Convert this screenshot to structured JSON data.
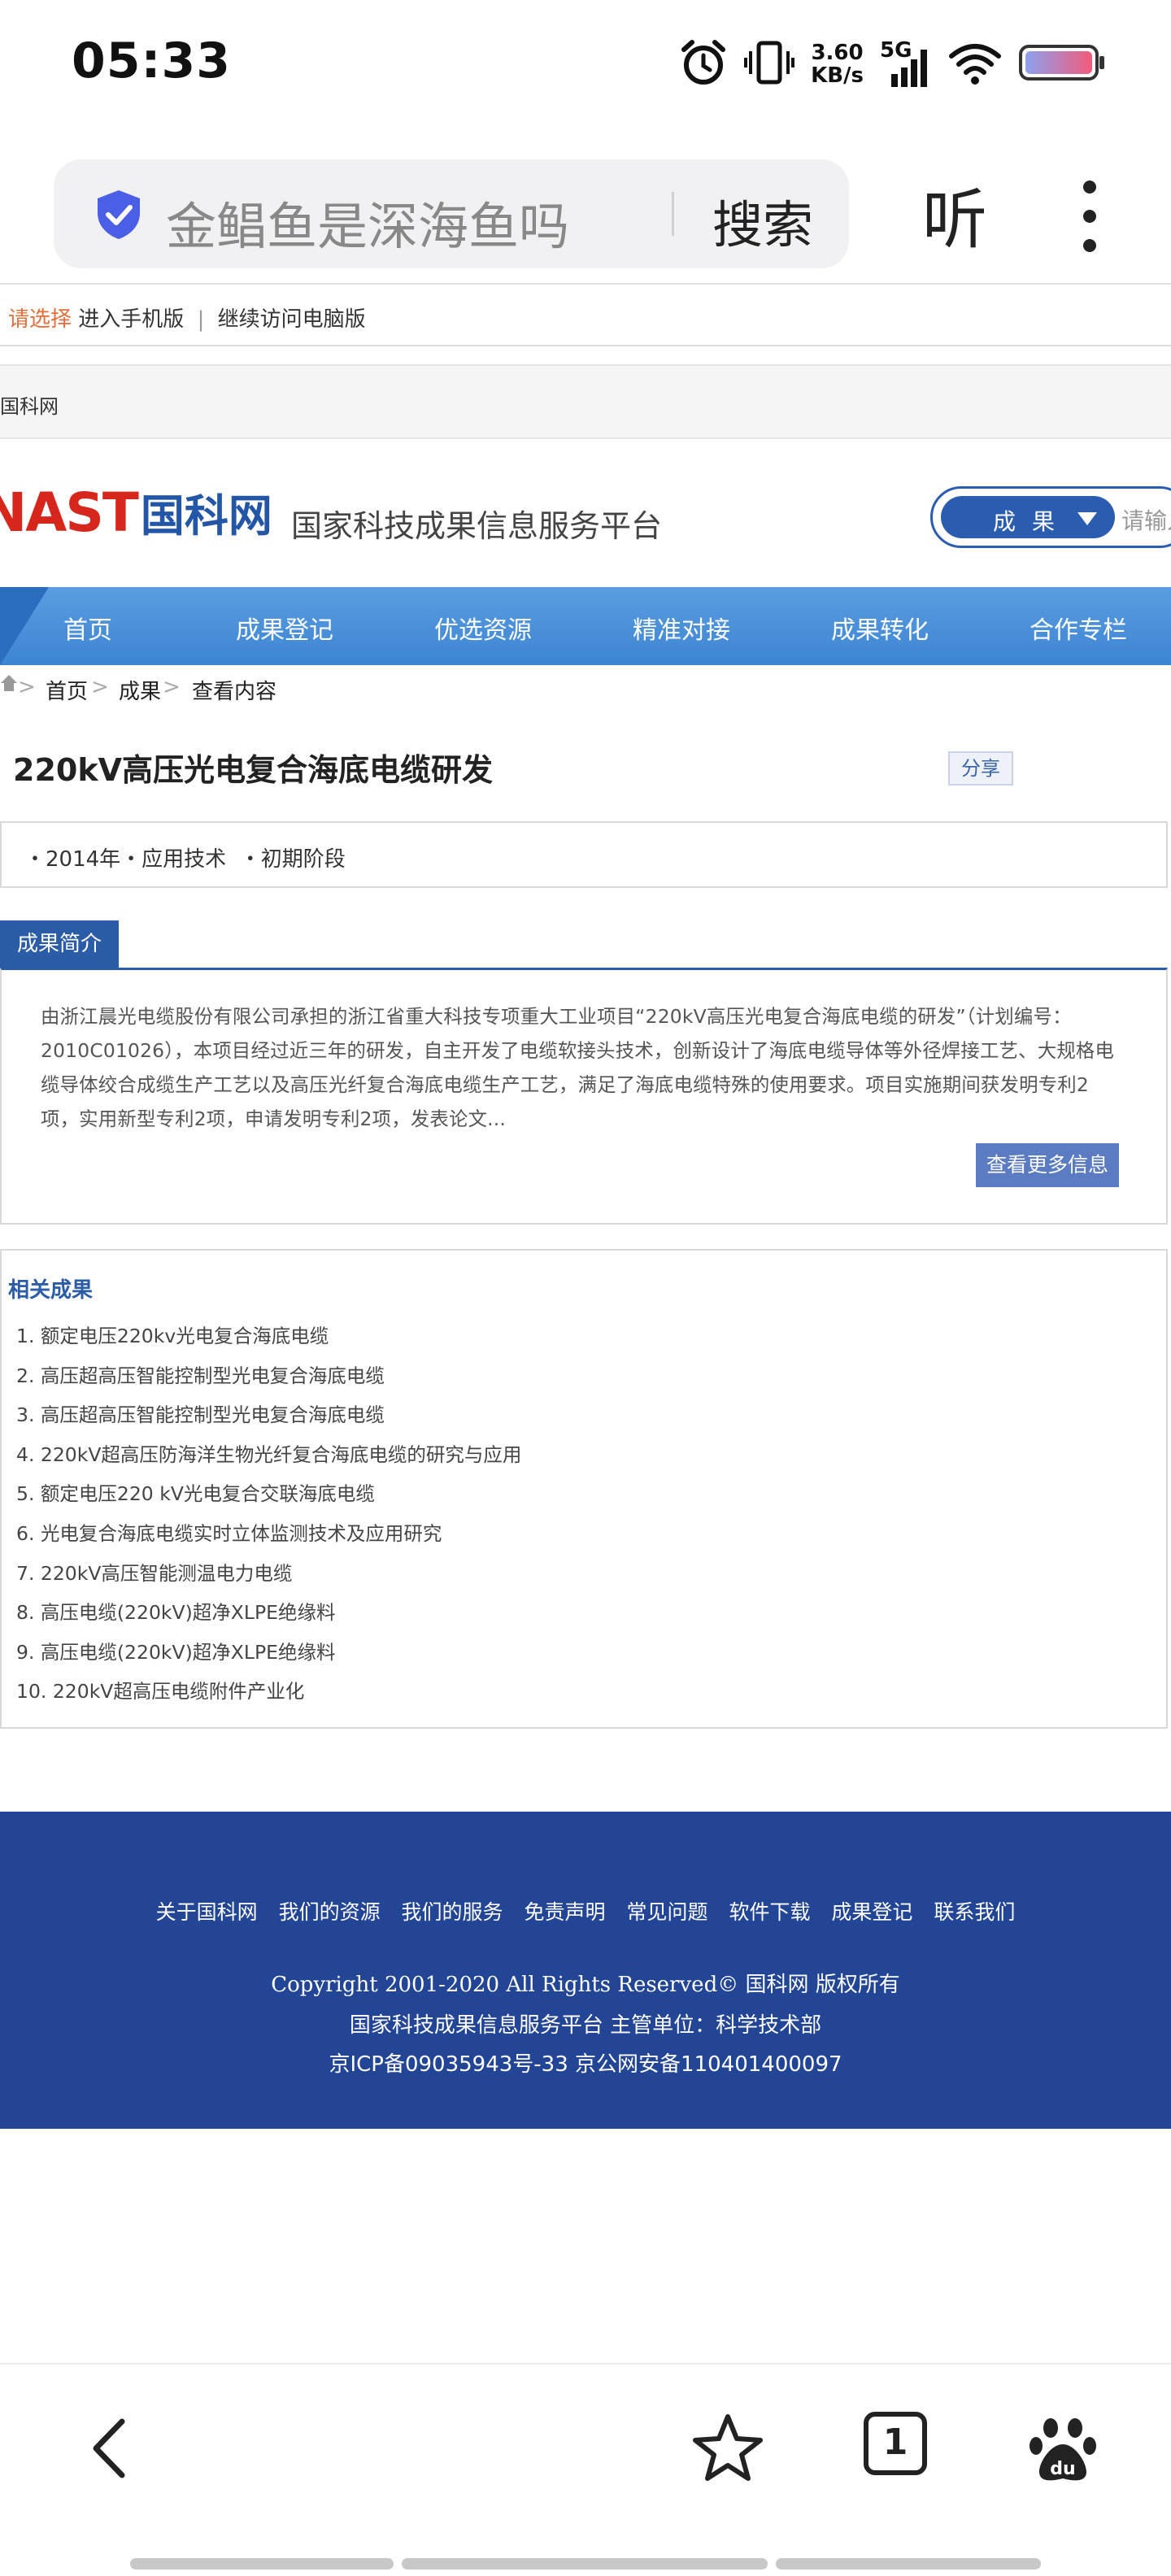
{
  "status_bar": {
    "time": "05:33",
    "net_speed_value": "3.60",
    "net_speed_unit": "KB/s",
    "network": "5G",
    "icons": [
      "alarm-icon",
      "vibrate-icon",
      "signal-icon",
      "wifi-icon",
      "battery-icon"
    ]
  },
  "browser": {
    "search_query": "金鲳鱼是深海鱼吗",
    "search_button": "搜索",
    "listen_button": "听"
  },
  "choose_bar": {
    "label": "请选择",
    "mobile": "进入手机版",
    "separator": "|",
    "desktop": "继续访问电脑版"
  },
  "top_strip": {
    "text": "国科网"
  },
  "header": {
    "logo_nast": "NAST",
    "logo_cn": "国科网",
    "subtitle": "国家科技成果信息服务平台",
    "search_category": "成果",
    "search_placeholder": "请输入"
  },
  "nav": {
    "items": [
      "首页",
      "成果登记",
      "优选资源",
      "精准对接",
      "成果转化",
      "合作专栏"
    ]
  },
  "breadcrumb": {
    "items": [
      "首页",
      "成果",
      "查看内容"
    ]
  },
  "article": {
    "title": "220kV高压光电复合海底电缆研发",
    "share": "分享",
    "meta": "・2014年・应用技术  ・初期阶段",
    "intro_tab": "成果简介",
    "intro": "由浙江晨光电缆股份有限公司承担的浙江省重大科技专项重大工业项目“220kV高压光电复合海底电缆的研发”（计划编号：2010C01026），本项目经过近三年的研发，自主开发了电缆软接头技术，创新设计了海底电缆导体等外径焊接工艺、大规格电缆导体绞合成缆生产工艺以及高压光纤复合海底电缆生产工艺，满足了海底电缆特殊的使用要求。项目实施期间获发明专利2项，实用新型专利2项，申请发明专利2项，发表论文...",
    "more_button": "查看更多信息"
  },
  "related": {
    "title": "相关成果",
    "items": [
      "1. 额定电压220kv光电复合海底电缆",
      "2. 高压超高压智能控制型光电复合海底电缆",
      "3. 高压超高压智能控制型光电复合海底电缆",
      "4. 220kV超高压防海洋生物光纤复合海底电缆的研究与应用",
      "5. 额定电压220 kV光电复合交联海底电缆",
      "6. 光电复合海底电缆实时立体监测技术及应用研究",
      "7. 220kV高压智能测温电力电缆",
      "8. 高压电缆(220kV)超净XLPE绝缘料",
      "9. 高压电缆(220kV)超净XLPE绝缘料",
      "10. 220kV超高压电缆附件产业化"
    ]
  },
  "footer": {
    "links": [
      "关于国科网",
      "我们的资源",
      "我们的服务",
      "免责声明",
      "常见问题",
      "软件下载",
      "成果登记",
      "联系我们"
    ],
    "copyright": "Copyright 2001-2020 All Rights Reserved© 国科网 版权所有",
    "line2": "国家科技成果信息服务平台   主管单位：科学技术部",
    "line3": "京ICP备09035943号-33  京公网安备110401400097"
  },
  "toolbar": {
    "tab_count": "1",
    "icons": [
      "back-icon",
      "star-icon",
      "tabs-icon",
      "baidu-icon"
    ]
  },
  "colors": {
    "brand_blue": "#234596",
    "nav_blue": "#4a90dc",
    "accent_orange": "#e0703a",
    "logo_red": "#d7271d"
  }
}
